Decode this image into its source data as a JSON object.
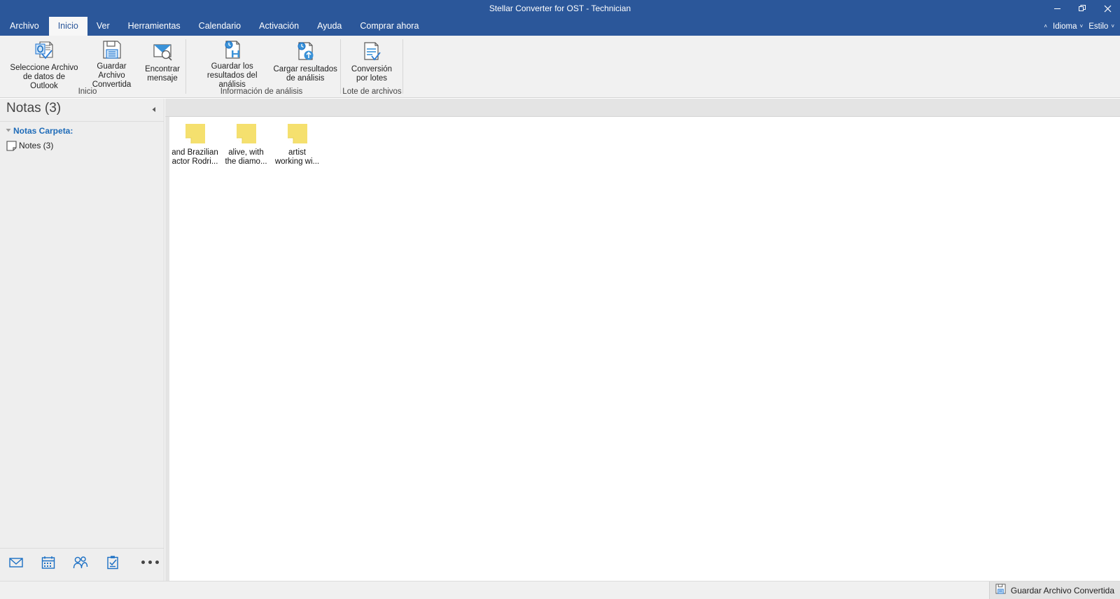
{
  "window": {
    "title": "Stellar Converter for OST - Technician",
    "controls": {
      "minimize": "—",
      "maximize": "❐",
      "close": "✕"
    },
    "accent_color": "#2b579a"
  },
  "tabs": [
    {
      "label": "Archivo",
      "active": false
    },
    {
      "label": "Inicio",
      "active": true
    },
    {
      "label": "Ver",
      "active": false
    },
    {
      "label": "Herramientas",
      "active": false
    },
    {
      "label": "Calendario",
      "active": false
    },
    {
      "label": "Activación",
      "active": false
    },
    {
      "label": "Ayuda",
      "active": false
    },
    {
      "label": "Comprar ahora",
      "active": false
    }
  ],
  "tabstrip_right": {
    "collapse_caret": "˄",
    "language": "Idioma",
    "language_caret": "˅",
    "style": "Estilo",
    "style_caret": "˅"
  },
  "ribbon": {
    "groups": [
      {
        "label": "Inicio",
        "buttons": [
          {
            "label": "Seleccione Archivo\nde datos de Outlook",
            "icon": "outlook-data-file-icon"
          },
          {
            "label": "Guardar Archivo\nConvertida",
            "icon": "save-floppy-icon"
          },
          {
            "label": "Encontrar\nmensaje",
            "icon": "find-message-icon"
          }
        ]
      },
      {
        "label": "Información de análisis",
        "buttons": [
          {
            "label": "Guardar los\nresultados del análisis",
            "icon": "save-scan-results-icon"
          },
          {
            "label": "Cargar resultados\nde análisis",
            "icon": "load-scan-results-icon"
          }
        ]
      },
      {
        "label": "Lote de archivos",
        "buttons": [
          {
            "label": "Conversión\npor lotes",
            "icon": "batch-conversion-icon"
          }
        ]
      }
    ]
  },
  "sidebar": {
    "title": "Notas (3)",
    "collapse_icon": "◀",
    "tree": {
      "expand_arrow": "◢",
      "root_label": "Notas Carpeta:",
      "child": {
        "label": "Notes (3)",
        "icon": "note-page-icon"
      }
    },
    "nav_buttons": [
      {
        "name": "mail",
        "icon": "mail-icon"
      },
      {
        "name": "calendar",
        "icon": "calendar-icon"
      },
      {
        "name": "people",
        "icon": "people-icon"
      },
      {
        "name": "tasks",
        "icon": "tasks-clipboard-icon"
      },
      {
        "name": "more",
        "icon": "ellipsis-icon"
      }
    ]
  },
  "content": {
    "notes": [
      {
        "label": "and Brazilian\nactor Rodri...",
        "icon": "sticky-note-icon"
      },
      {
        "label": "alive, with\nthe diamo...",
        "icon": "sticky-note-icon"
      },
      {
        "label": "artist\nworking wi...",
        "icon": "sticky-note-icon"
      }
    ],
    "note_color": "#f5e06e"
  },
  "taskbar": {
    "item": {
      "label": "Guardar Archivo Convertida",
      "icon": "save-floppy-icon"
    }
  }
}
